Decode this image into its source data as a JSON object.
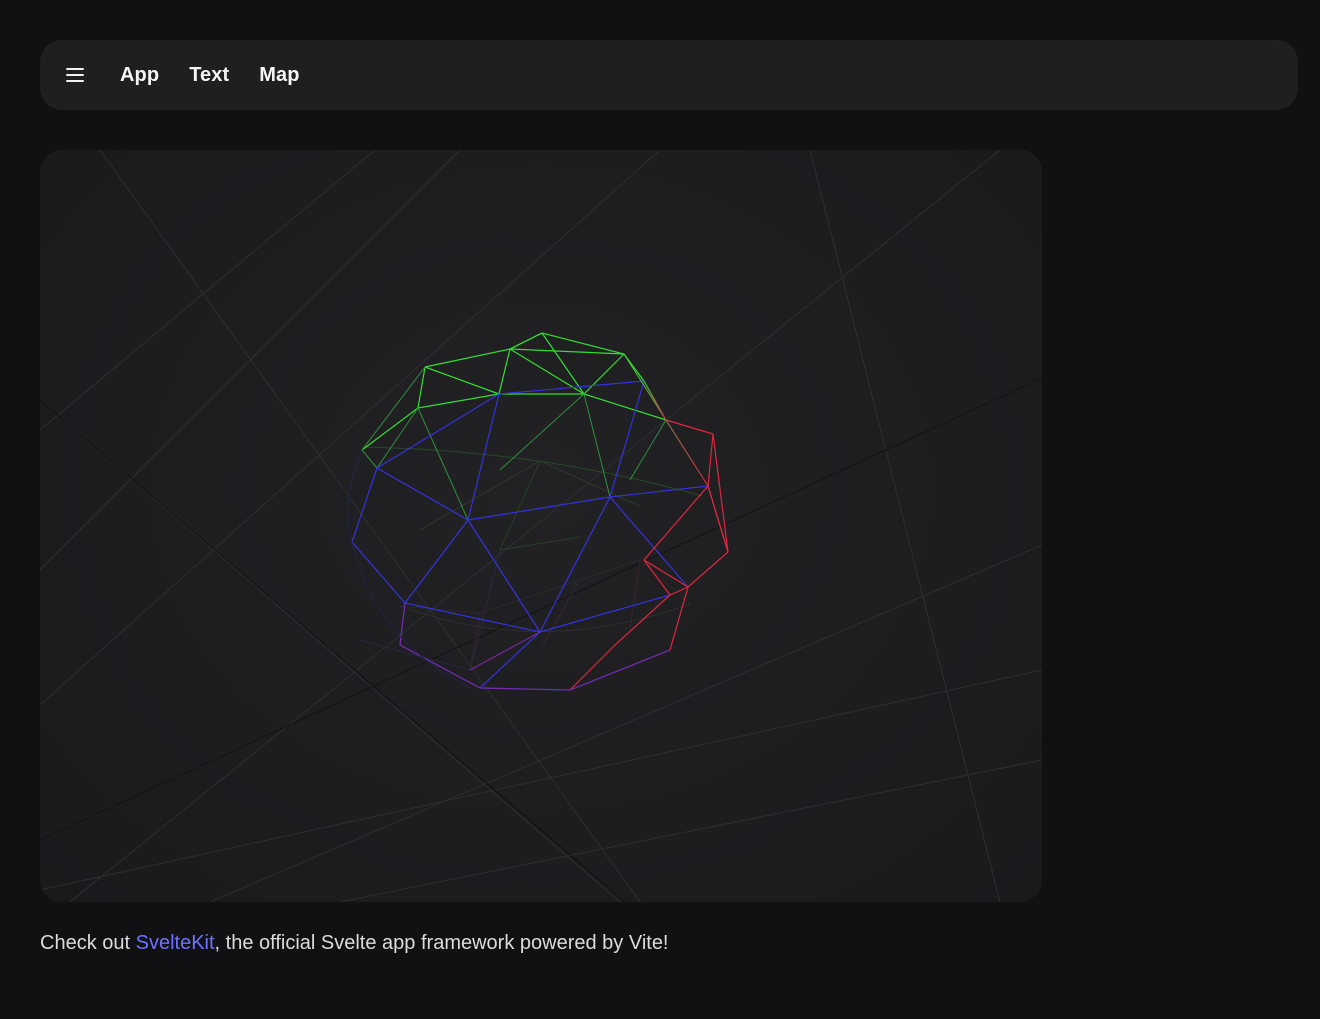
{
  "nav": {
    "links": [
      "App",
      "Text",
      "Map"
    ]
  },
  "footer": {
    "prefix": "Check out ",
    "link": "SvelteKit",
    "suffix": ", the official Svelte app framework powered by Vite!"
  },
  "colors": {
    "background": "#111114",
    "panel": "#1f1f21",
    "link": "#6c72ff"
  }
}
